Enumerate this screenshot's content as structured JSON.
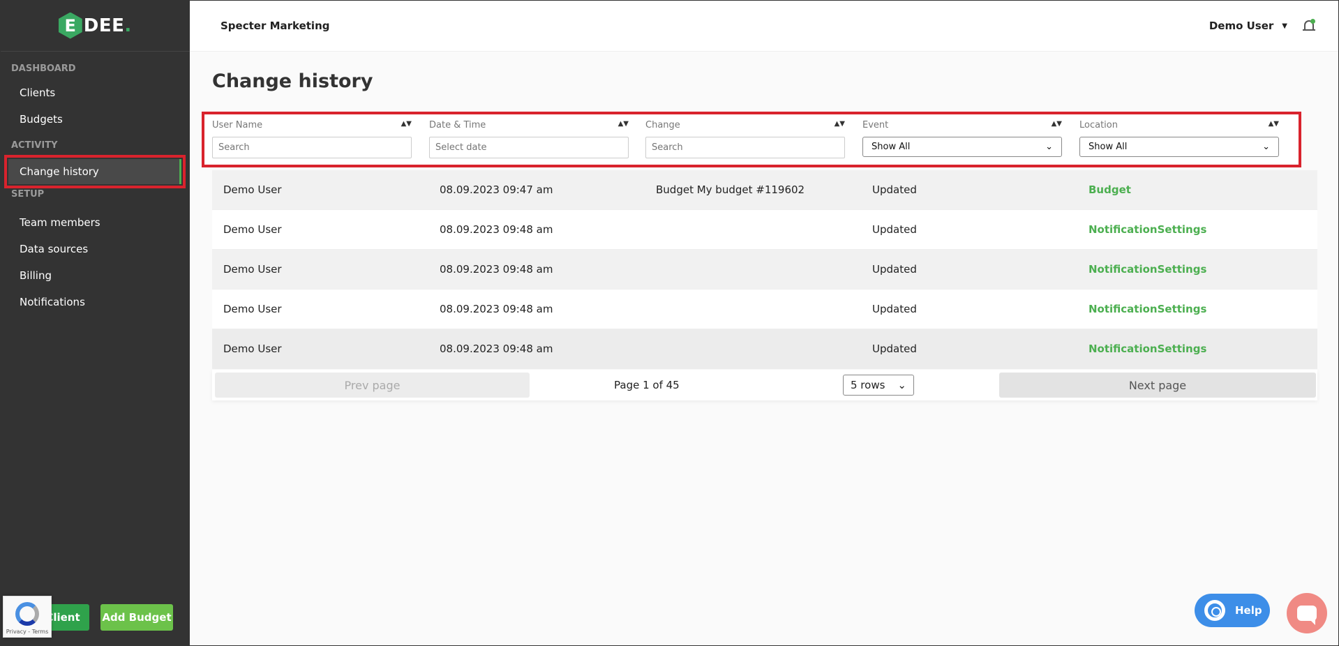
{
  "brand": {
    "logo_letter": "E",
    "logo_text": "DEE",
    "logo_dot": ".",
    "accent": "#4caf50"
  },
  "topbar": {
    "company": "Specter Marketing",
    "user": "Demo User"
  },
  "sidebar": {
    "sections": [
      {
        "title": "DASHBOARD",
        "items": [
          "Clients",
          "Budgets"
        ]
      },
      {
        "title": "ACTIVITY",
        "items": [
          "Change history"
        ]
      },
      {
        "title": "SETUP",
        "items": [
          "Team members",
          "Data sources",
          "Billing",
          "Notifications"
        ]
      }
    ],
    "add_client": "Client",
    "add_budget": "Add Budget",
    "recaptcha": "Privacy - Terms"
  },
  "page": {
    "title": "Change history"
  },
  "filters": [
    {
      "label": "User Name",
      "placeholder": "Search"
    },
    {
      "label": "Date & Time",
      "placeholder": "Select date"
    },
    {
      "label": "Change",
      "placeholder": "Search"
    },
    {
      "label": "Event",
      "value": "Show All"
    },
    {
      "label": "Location",
      "value": "Show All"
    }
  ],
  "rows": [
    {
      "user": "Demo User",
      "datetime": "08.09.2023 09:47 am",
      "change": "Budget My budget #119602",
      "event": "Updated",
      "location": "Budget"
    },
    {
      "user": "Demo User",
      "datetime": "08.09.2023 09:48 am",
      "change": "",
      "event": "Updated",
      "location": "NotificationSettings"
    },
    {
      "user": "Demo User",
      "datetime": "08.09.2023 09:48 am",
      "change": "",
      "event": "Updated",
      "location": "NotificationSettings"
    },
    {
      "user": "Demo User",
      "datetime": "08.09.2023 09:48 am",
      "change": "",
      "event": "Updated",
      "location": "NotificationSettings"
    },
    {
      "user": "Demo User",
      "datetime": "08.09.2023 09:48 am",
      "change": "",
      "event": "Updated",
      "location": "NotificationSettings"
    }
  ],
  "pagination": {
    "prev": "Prev page",
    "info": "Page 1 of 45",
    "rows": "5 rows",
    "next": "Next page"
  },
  "widgets": {
    "help": "Help"
  }
}
